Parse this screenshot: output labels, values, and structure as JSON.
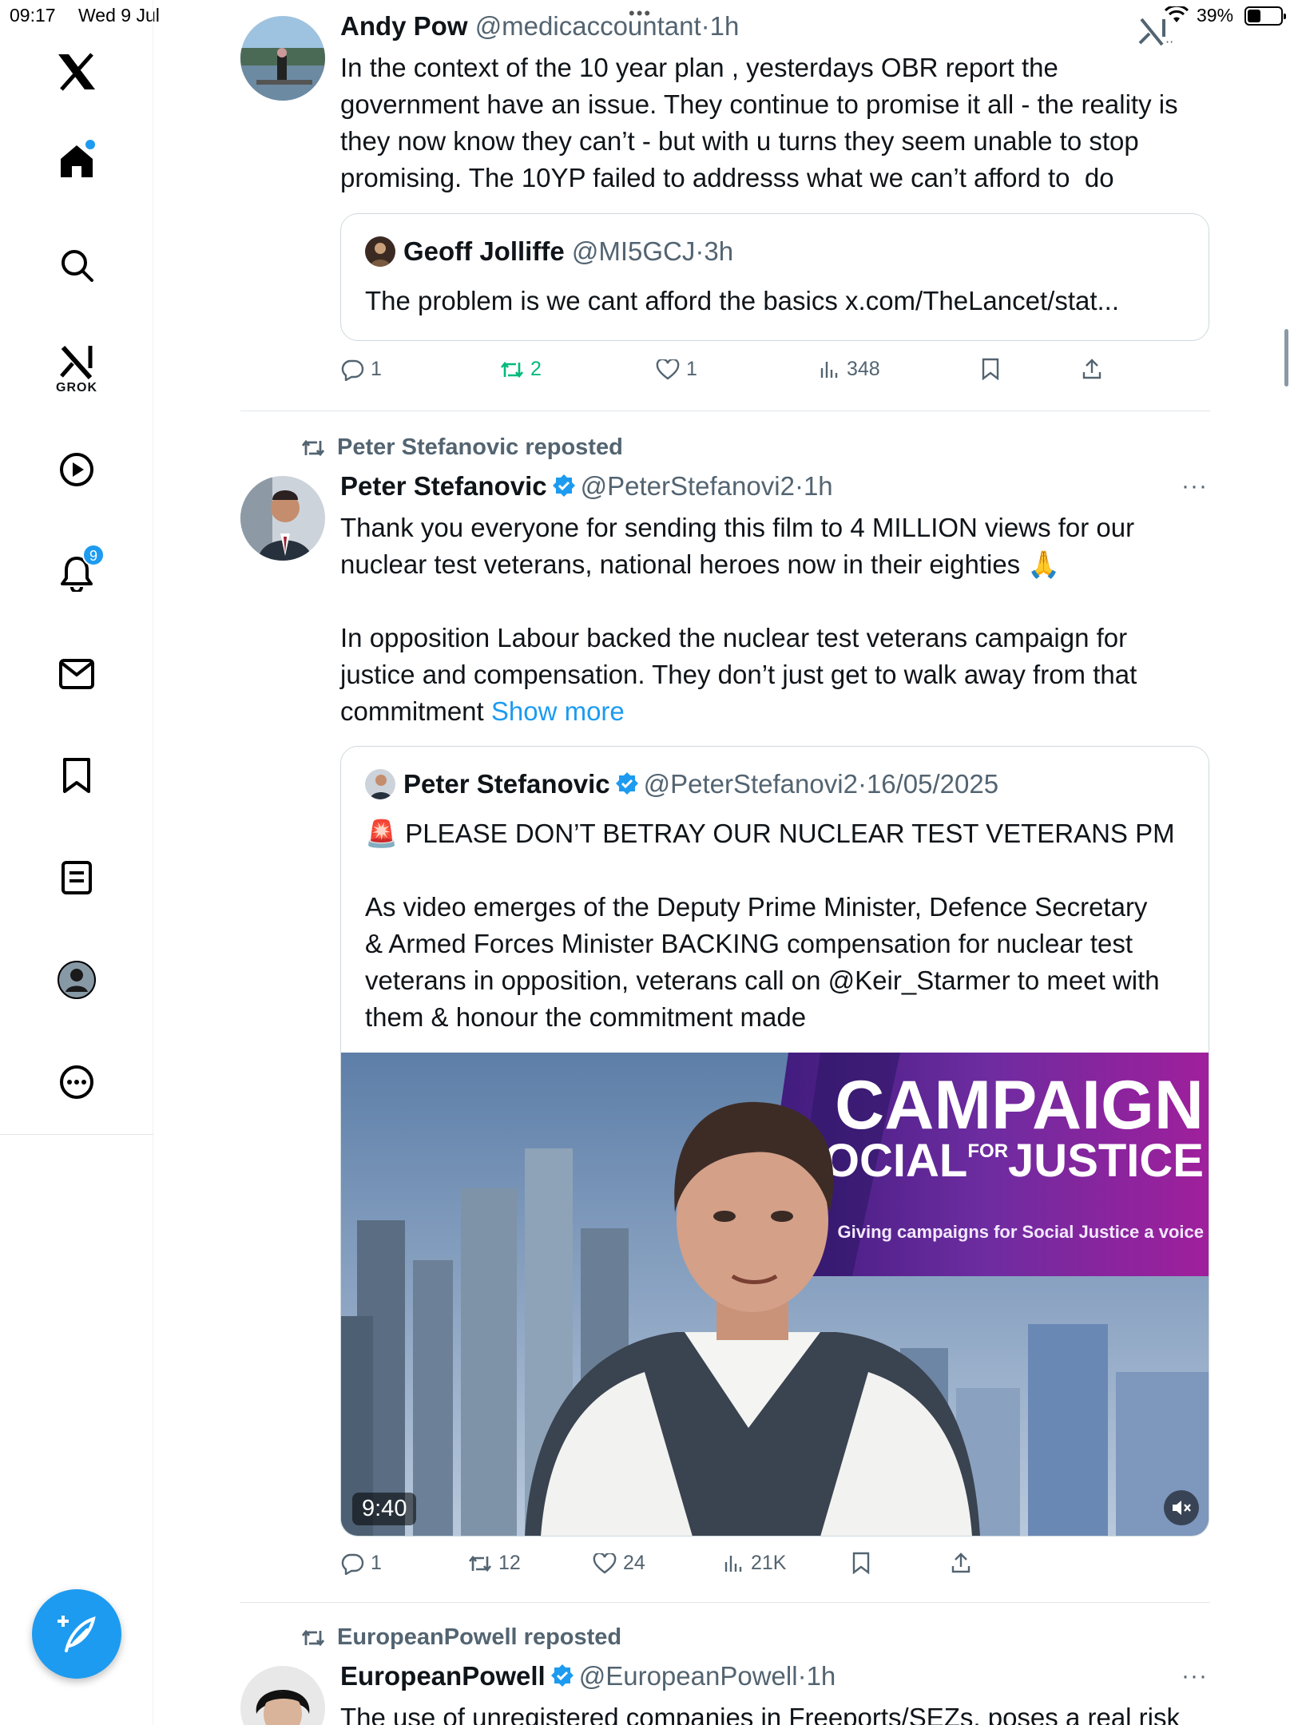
{
  "status_bar": {
    "time": "09:17",
    "date": "Wed 9 Jul",
    "battery": "39%",
    "battery_fraction": 0.39
  },
  "sidebar": {
    "items": [
      {
        "icon": "x-logo-icon"
      },
      {
        "icon": "home-icon",
        "has_dot": true
      },
      {
        "icon": "search-icon"
      },
      {
        "icon": "grok-icon",
        "label": "GROK"
      },
      {
        "icon": "video-icon"
      },
      {
        "icon": "notifications-icon",
        "badge": "9"
      },
      {
        "icon": "messages-icon"
      },
      {
        "icon": "bookmarks-icon"
      },
      {
        "icon": "lists-icon"
      },
      {
        "icon": "profile-icon"
      },
      {
        "icon": "more-icon"
      }
    ],
    "compose_icon": "compose-icon"
  },
  "feed": {
    "tweet1": {
      "name": "Andy Pow",
      "handle": "@medicaccountant",
      "sep": "·",
      "time": "1h",
      "text": "In the context of the 10 year plan , yesterdays OBR report the\ngovernment have an issue. They continue to promise it all - the reality is\nthey now know they can’t - but with u turns they seem unable to stop\npromising. The 10YP failed to addresss what we can’t afford to  do",
      "quote": {
        "name": "Geoff Jolliffe",
        "handle": "@MI5GCJ",
        "sep": "·",
        "time": "3h",
        "text": "The problem is we cant afford the basics x.com/TheLancet/stat..."
      },
      "stats": {
        "replies": "1",
        "reposts": "2",
        "likes": "1",
        "views": "348"
      }
    },
    "tweet2": {
      "reposted_by": "Peter Stefanovic reposted",
      "name": "Peter Stefanovic",
      "handle": "@PeterStefanovi2",
      "sep": "·",
      "time": "1h",
      "text": "Thank you everyone for sending this film to 4 MILLION views for our\nnuclear test veterans, national heroes now in their eighties 🙏\n\nIn opposition Labour backed the nuclear test veterans campaign for\njustice and compensation. They don’t just get to walk away from that\ncommitment ",
      "show_more": "Show more",
      "quote": {
        "name": "Peter Stefanovic",
        "handle": "@PeterStefanovi2",
        "sep": "·",
        "time": "16/05/2025",
        "text": "🚨 PLEASE DON’T BETRAY OUR NUCLEAR TEST VETERANS PM\n\nAs video emerges of the Deputy Prime Minister, Defence Secretary\n& Armed Forces Minister BACKING compensation for nuclear test\nveterans in opposition, veterans call on @Keir_Starmer to meet with\nthem & honour the commitment made",
        "video": {
          "banner_line1": "CAMPAIGN",
          "banner_line2a": "SOCIAL",
          "banner_for": "FOR",
          "banner_line2b": "JUSTICE",
          "banner_tagline": "Giving campaigns for Social Justice a voice",
          "duration": "9:40"
        }
      },
      "stats": {
        "replies": "1",
        "reposts": "12",
        "likes": "24",
        "views": "21K"
      }
    },
    "tweet3": {
      "reposted_by": "EuropeanPowell reposted",
      "name": "EuropeanPowell",
      "handle": "@EuropeanPowell",
      "sep": "·",
      "time": "1h",
      "text": "The use of unregistered companies in Freeports/SEZs, poses a real risk"
    }
  },
  "colors": {
    "accent": "#1d9bf0",
    "repost_green": "#00ba7c",
    "secondary_text": "#536471",
    "border": "#cfd9de"
  }
}
